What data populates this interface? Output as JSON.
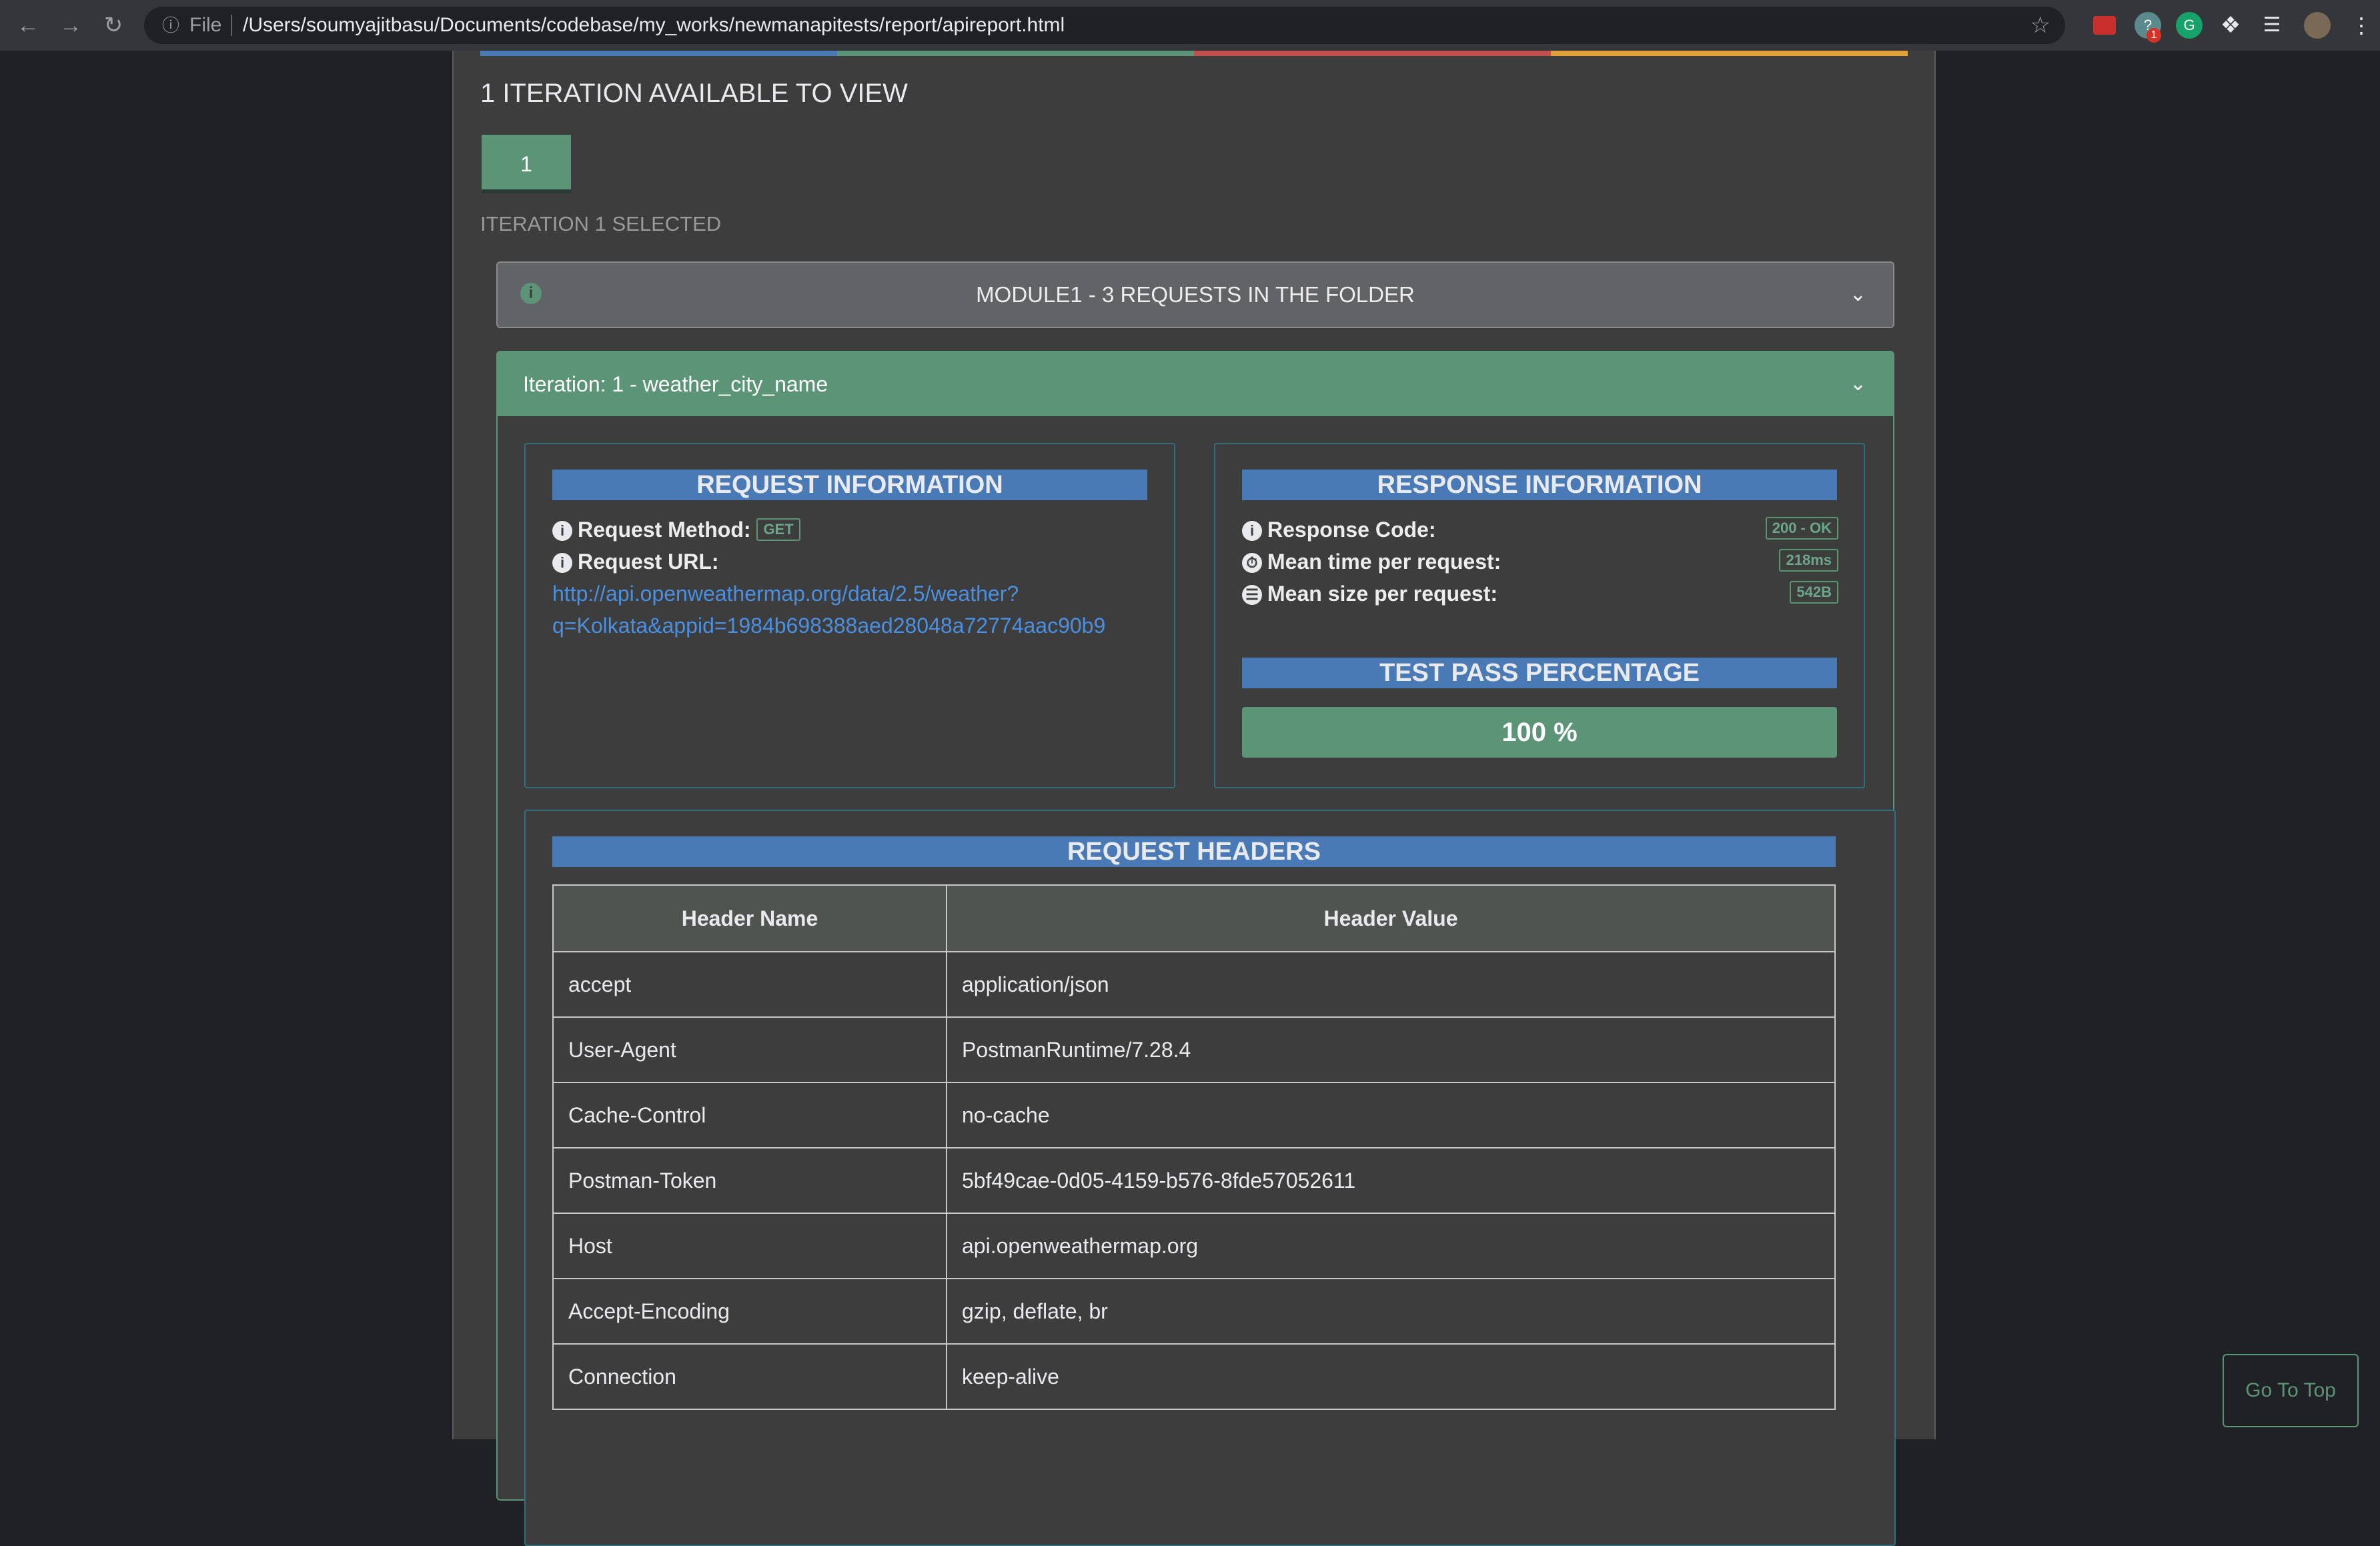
{
  "browser": {
    "scheme_label": "File",
    "url": "/Users/soumyajitbasu/Documents/codebase/my_works/newmanapitests/report/apireport.html",
    "extension_badge": "1",
    "icons": [
      "back-icon",
      "forward-icon",
      "reload-icon",
      "info-icon",
      "star-icon",
      "puzzle-icon",
      "reading-list-icon",
      "profile-avatar",
      "menu-icon"
    ]
  },
  "colorbar": [
    "#4a7ab5",
    "#5b9476",
    "#c0504d",
    "#e0a03a"
  ],
  "iterations": {
    "title": "1 ITERATION AVAILABLE TO VIEW",
    "button_label": "1",
    "selected_text": "ITERATION 1 SELECTED"
  },
  "module": {
    "label": "MODULE1 - 3 REQUESTS IN THE FOLDER"
  },
  "iteration_card": {
    "title": "Iteration: 1 - weather_city_name"
  },
  "request_info": {
    "title": "REQUEST INFORMATION",
    "method_label": "Request Method:",
    "method_value": "GET",
    "url_label": "Request URL:",
    "url_line1": "http://api.openweathermap.org/data/2.5/weather?",
    "url_line2": "q=Kolkata&appid=1984b698388aed28048a72774aac90b9"
  },
  "response_info": {
    "title": "RESPONSE INFORMATION",
    "code_label": "Response Code:",
    "code_value": "200 - OK",
    "time_label": "Mean time per request:",
    "time_value": "218ms",
    "size_label": "Mean size per request:",
    "size_value": "542B"
  },
  "test_pass": {
    "title": "TEST PASS PERCENTAGE",
    "value": "100 %",
    "percent": 100
  },
  "request_headers": {
    "title": "REQUEST HEADERS",
    "columns": [
      "Header Name",
      "Header Value"
    ],
    "rows": [
      [
        "accept",
        "application/json"
      ],
      [
        "User-Agent",
        "PostmanRuntime/7.28.4"
      ],
      [
        "Cache-Control",
        "no-cache"
      ],
      [
        "Postman-Token",
        "5bf49cae-0d05-4159-b576-8fde57052611"
      ],
      [
        "Host",
        "api.openweathermap.org"
      ],
      [
        "Accept-Encoding",
        "gzip, deflate, br"
      ],
      [
        "Connection",
        "keep-alive"
      ]
    ]
  },
  "go_top": "Go To Top"
}
